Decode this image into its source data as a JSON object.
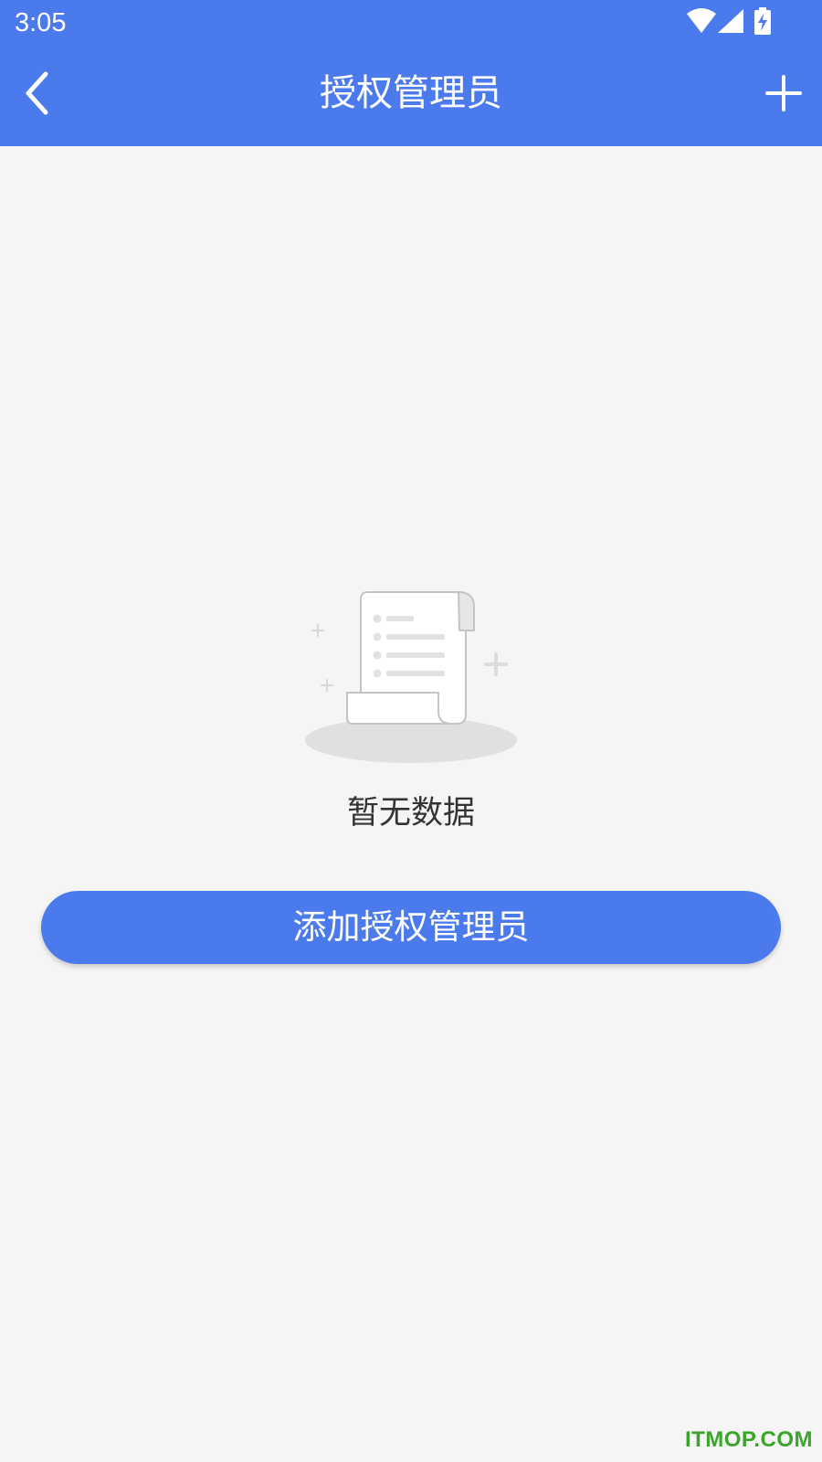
{
  "status_bar": {
    "time": "3:05",
    "icons": [
      "wifi-icon",
      "signal-icon",
      "battery-charging-icon"
    ]
  },
  "toolbar": {
    "title": "授权管理员",
    "back_icon": "chevron-left-icon",
    "add_icon": "plus-icon"
  },
  "empty_state": {
    "illustration": "document-scroll-icon",
    "message": "暂无数据"
  },
  "actions": {
    "add_admin_label": "添加授权管理员"
  },
  "watermark": {
    "text": "ITMOP.COM"
  },
  "colors": {
    "primary": "#4a7aec",
    "background": "#f5f5f5",
    "text": "#333333",
    "watermark": "#3aa52a"
  }
}
